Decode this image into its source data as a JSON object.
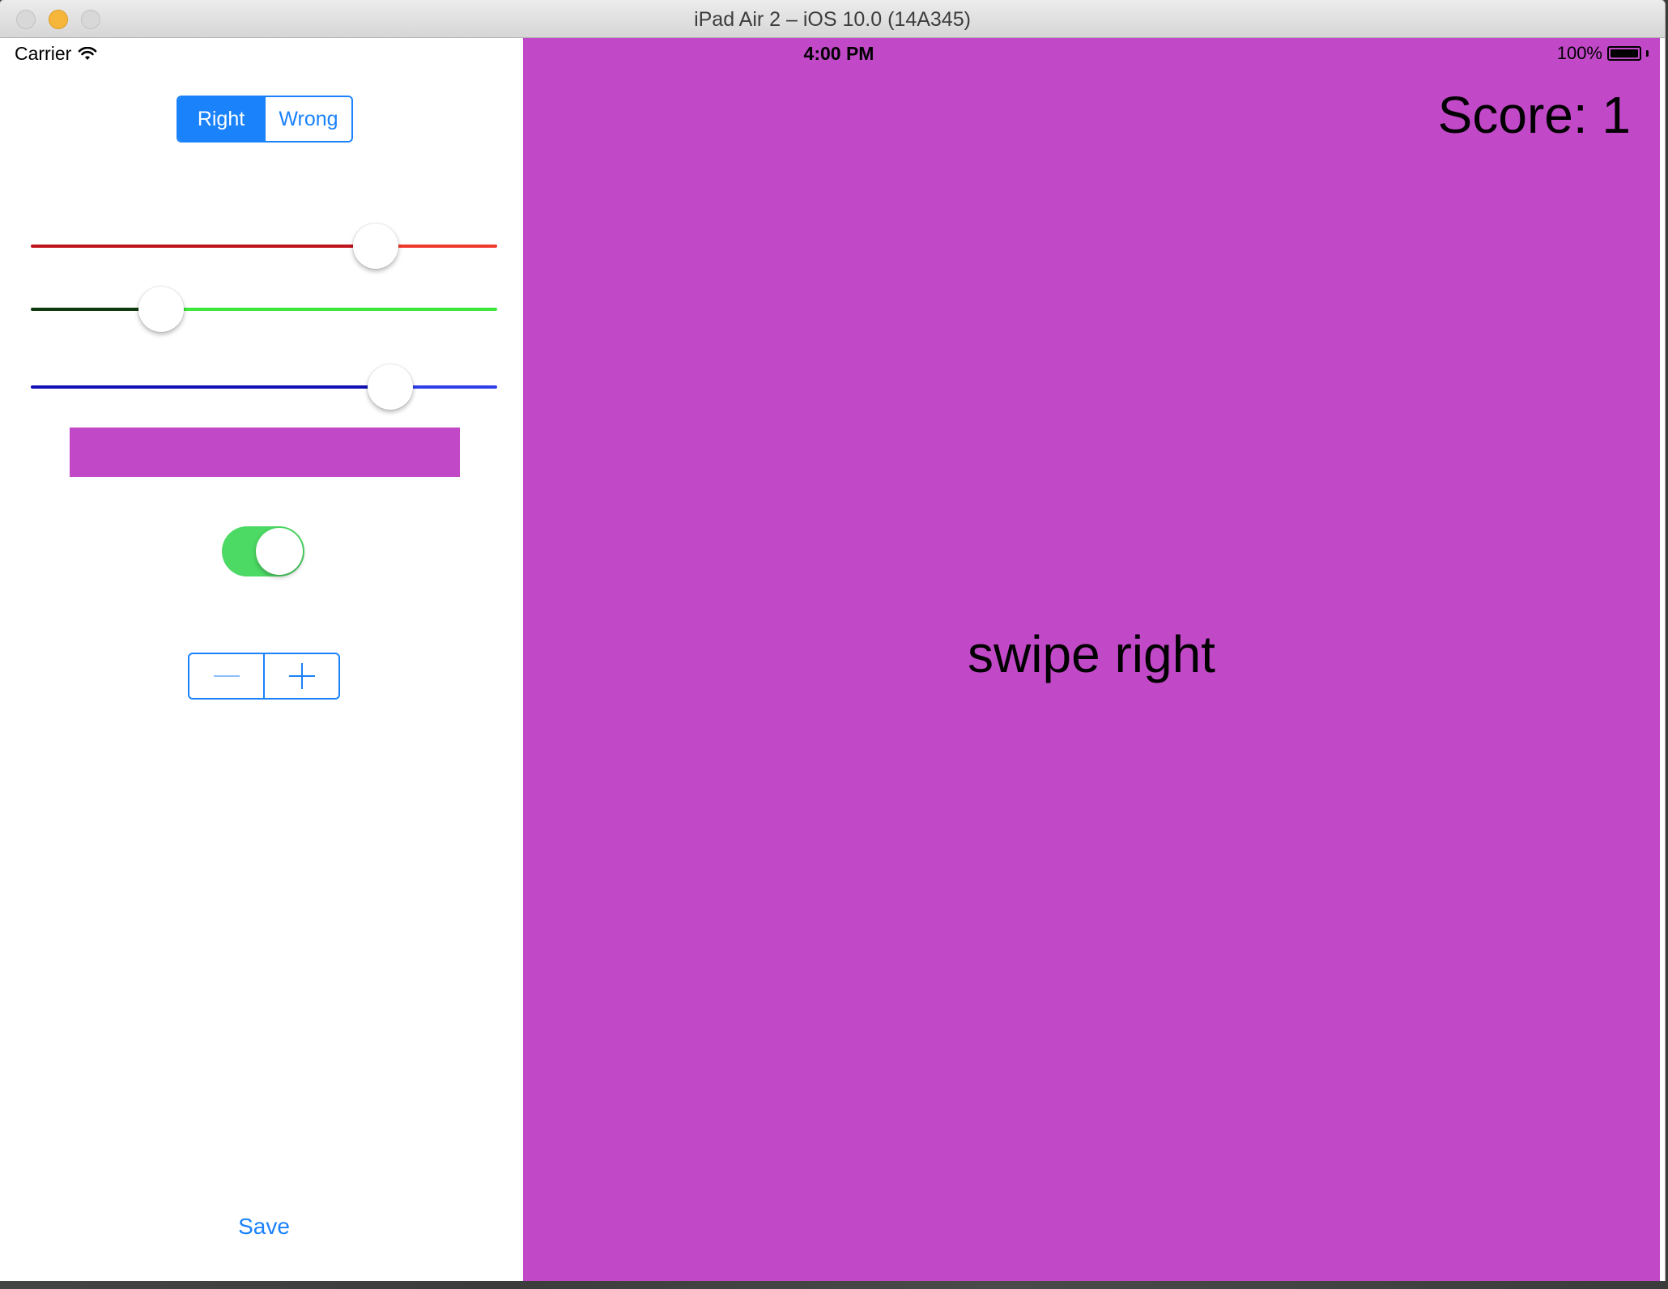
{
  "window": {
    "title": "iPad Air 2 – iOS 10.0 (14A345)"
  },
  "status_bar": {
    "carrier": "Carrier",
    "time": "4:00 PM",
    "battery": "100%"
  },
  "segmented_control": {
    "segments": [
      "Right",
      "Wrong"
    ],
    "selected": "Right",
    "accent_color": "#1a82fb"
  },
  "sliders": [
    {
      "name": "red-slider",
      "value": 0.74,
      "min_track_color": "#c0141b",
      "max_track_color": "#f03a2e"
    },
    {
      "name": "green-slider",
      "value": 0.28,
      "min_track_color": "#0f3a0f",
      "max_track_color": "#3de63a"
    },
    {
      "name": "blue-slider",
      "value": 0.77,
      "min_track_color": "#1010b4",
      "max_track_color": "#2f3fe8"
    }
  ],
  "swatch": {
    "color": "#c149c8"
  },
  "toggle": {
    "on": true,
    "on_color": "#4cd964"
  },
  "stepper": {
    "minus_icon": "minus-icon",
    "plus_icon": "plus-icon"
  },
  "save_label": "Save",
  "game": {
    "background": "#c149c8",
    "score_text": "Score: 1",
    "prompt_text": "swipe right"
  }
}
